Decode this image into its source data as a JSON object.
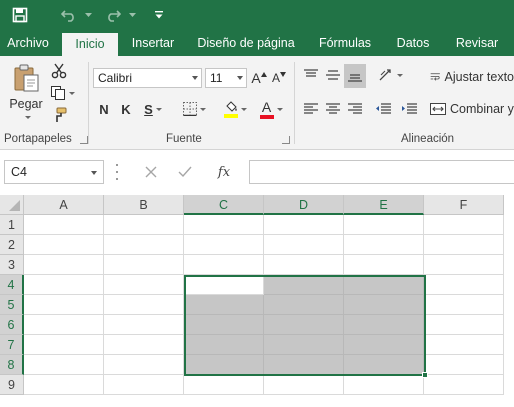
{
  "quick_access": {
    "save_icon": "save-icon",
    "undo_icon": "undo-icon",
    "redo_icon": "redo-icon",
    "customize_icon": "customize-qat-icon"
  },
  "tabs": [
    {
      "label": "Archivo",
      "active": false
    },
    {
      "label": "Inicio",
      "active": true
    },
    {
      "label": "Insertar",
      "active": false
    },
    {
      "label": "Diseño de página",
      "active": false
    },
    {
      "label": "Fórmulas",
      "active": false
    },
    {
      "label": "Datos",
      "active": false
    },
    {
      "label": "Revisar",
      "active": false
    }
  ],
  "ribbon": {
    "clipboard": {
      "group_label": "Portapapeles",
      "paste_label": "Pegar"
    },
    "font": {
      "group_label": "Fuente",
      "font_name": "Calibri",
      "font_size": "11",
      "grow_label": "A",
      "shrink_label": "A",
      "bold_label": "N",
      "italic_label": "K",
      "underline_label": "S",
      "font_color_letter": "A",
      "highlight_color": "#ffff00",
      "font_color": "#e81123"
    },
    "alignment": {
      "group_label": "Alineación",
      "wrap_text_label": "Ajustar texto",
      "merge_label": "Combinar y"
    }
  },
  "formula_bar": {
    "name_box": "C4",
    "cancel_icon": "cancel-icon",
    "enter_icon": "check-icon",
    "function_label": "fx",
    "value": ""
  },
  "grid": {
    "columns": [
      "A",
      "B",
      "C",
      "D",
      "E",
      "F"
    ],
    "rows": [
      "1",
      "2",
      "3",
      "4",
      "5",
      "6",
      "7",
      "8",
      "9"
    ],
    "selected_range": "C4:E8",
    "active_cell": "C4",
    "accent_color": "#217346"
  }
}
